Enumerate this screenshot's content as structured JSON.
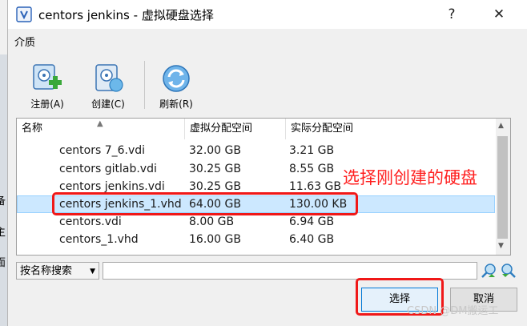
{
  "window": {
    "title": "centors jenkins - 虚拟硬盘选择",
    "help_glyph": "?",
    "close_glyph": "✕"
  },
  "menu": {
    "media_label": "介质"
  },
  "toolbar": {
    "register_label": "注册(A)",
    "create_label": "创建(C)",
    "refresh_label": "刷新(R)"
  },
  "list": {
    "columns": [
      "名称",
      "虚拟分配空间",
      "实际分配空间"
    ],
    "rows": [
      {
        "name": "centors 7_6.vdi",
        "virtual": "32.00 GB",
        "actual": "3.21 GB"
      },
      {
        "name": "centors gitlab.vdi",
        "virtual": "30.25 GB",
        "actual": "8.55 GB"
      },
      {
        "name": "centors jenkins.vdi",
        "virtual": "30.25 GB",
        "actual": "11.63 GB"
      },
      {
        "name": "centors jenkins_1.vhd",
        "virtual": "64.00 GB",
        "actual": "130.00 KB"
      },
      {
        "name": "centors.vdi",
        "virtual": "8.00 GB",
        "actual": "6.94 GB"
      },
      {
        "name": "centors_1.vhd",
        "virtual": "16.00 GB",
        "actual": "6.40 GB"
      }
    ],
    "selected_row": "centors jenkins_1.vhd"
  },
  "search": {
    "mode_label": "按名称搜索",
    "query": ""
  },
  "buttons": {
    "select_label": "选择",
    "cancel_label": "取消"
  },
  "annotation": {
    "text": "选择刚创建的硬盘"
  },
  "watermark": {
    "text": "CSDN @DM搬运工"
  },
  "background_fragments": [
    "备",
    "主",
    "面"
  ],
  "colors": {
    "selection": "#cce8ff",
    "annotation_red": "#f01818",
    "accent": "#0078d7"
  }
}
